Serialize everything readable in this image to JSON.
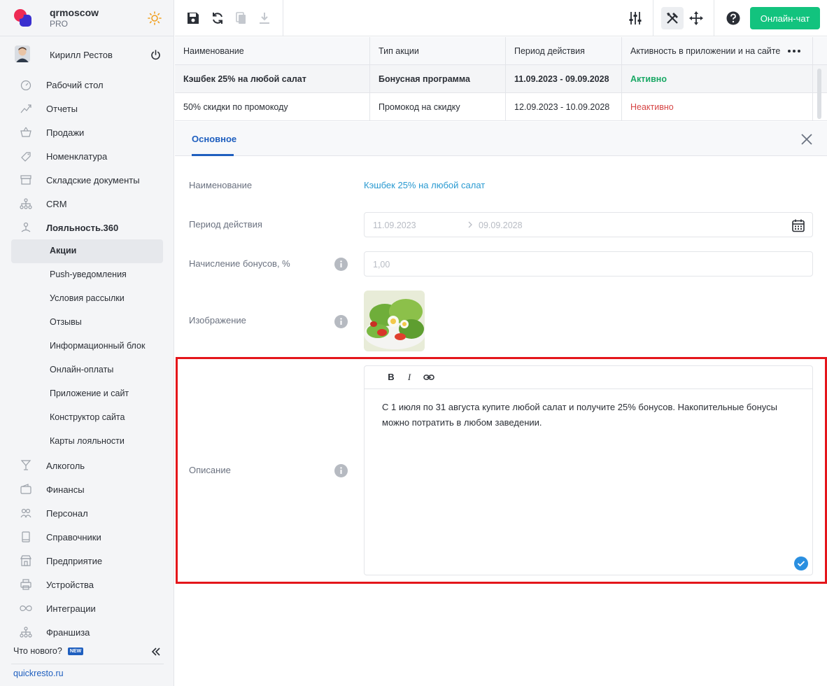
{
  "brand": {
    "name": "qrmoscow",
    "plan": "PRO"
  },
  "user": {
    "name": "Кирилл Рестов"
  },
  "nav": {
    "items_top": [
      {
        "label": "Рабочий стол",
        "icon": "gauge-icon"
      },
      {
        "label": "Отчеты",
        "icon": "chart-icon"
      },
      {
        "label": "Продажи",
        "icon": "basket-icon"
      },
      {
        "label": "Номенклатура",
        "icon": "tag-icon"
      },
      {
        "label": "Складские документы",
        "icon": "archive-icon"
      },
      {
        "label": "CRM",
        "icon": "hierarchy-icon"
      },
      {
        "label": "Лояльность.360",
        "icon": "loyalty-icon"
      }
    ],
    "sub_items": [
      {
        "label": "Акции",
        "active": true
      },
      {
        "label": "Push-уведомления"
      },
      {
        "label": "Условия рассылки"
      },
      {
        "label": "Отзывы"
      },
      {
        "label": "Информационный блок"
      },
      {
        "label": "Онлайн-оплаты"
      },
      {
        "label": "Приложение и сайт"
      },
      {
        "label": "Конструктор сайта"
      },
      {
        "label": "Карты лояльности"
      }
    ],
    "items_bottom": [
      {
        "label": "Алкоголь",
        "icon": "glass-icon"
      },
      {
        "label": "Финансы",
        "icon": "wallet-icon"
      },
      {
        "label": "Персонал",
        "icon": "people-icon"
      },
      {
        "label": "Справочники",
        "icon": "book-icon"
      },
      {
        "label": "Предприятие",
        "icon": "store-icon"
      },
      {
        "label": "Устройства",
        "icon": "printer-icon"
      },
      {
        "label": "Интеграции",
        "icon": "infinity-icon"
      },
      {
        "label": "Франшиза",
        "icon": "hierarchy-icon"
      }
    ],
    "whats_new": "Что нового?",
    "new_badge": "NEW",
    "site_link": "quickresto.ru"
  },
  "toolbar": {
    "chat_label": "Онлайн-чат"
  },
  "table": {
    "columns": [
      "Наименование",
      "Тип акции",
      "Период действия",
      "Активность в приложении и на сайте"
    ],
    "rows": [
      {
        "name": "Кэшбек 25% на любой салат",
        "type": "Бонусная программа",
        "period": "11.09.2023 - 09.09.2028",
        "status": "Активно"
      },
      {
        "name": "50% скидки по промокоду",
        "type": "Промокод на скидку",
        "period": "12.09.2023 - 10.09.2028",
        "status": "Неактивно"
      }
    ]
  },
  "tabs": {
    "main": "Основное"
  },
  "form": {
    "name_label": "Наименование",
    "name_value": "Кэшбек 25% на любой салат",
    "period_label": "Период действия",
    "period_start": "11.09.2023",
    "period_end": "09.09.2028",
    "bonus_label": "Начисление бонусов, %",
    "bonus_placeholder": "1,00",
    "image_label": "Изображение",
    "description_label": "Описание",
    "description_text": "С 1 июля по 31 августа купите любой салат и получите 25% бонусов. Накопительные бонусы можно потратить в любом заведении."
  },
  "colors": {
    "accent": "#1f5fbf",
    "chat_button": "#12c37e",
    "highlight": "#e4161b",
    "active": "#1aa865",
    "inactive": "#d64545"
  }
}
